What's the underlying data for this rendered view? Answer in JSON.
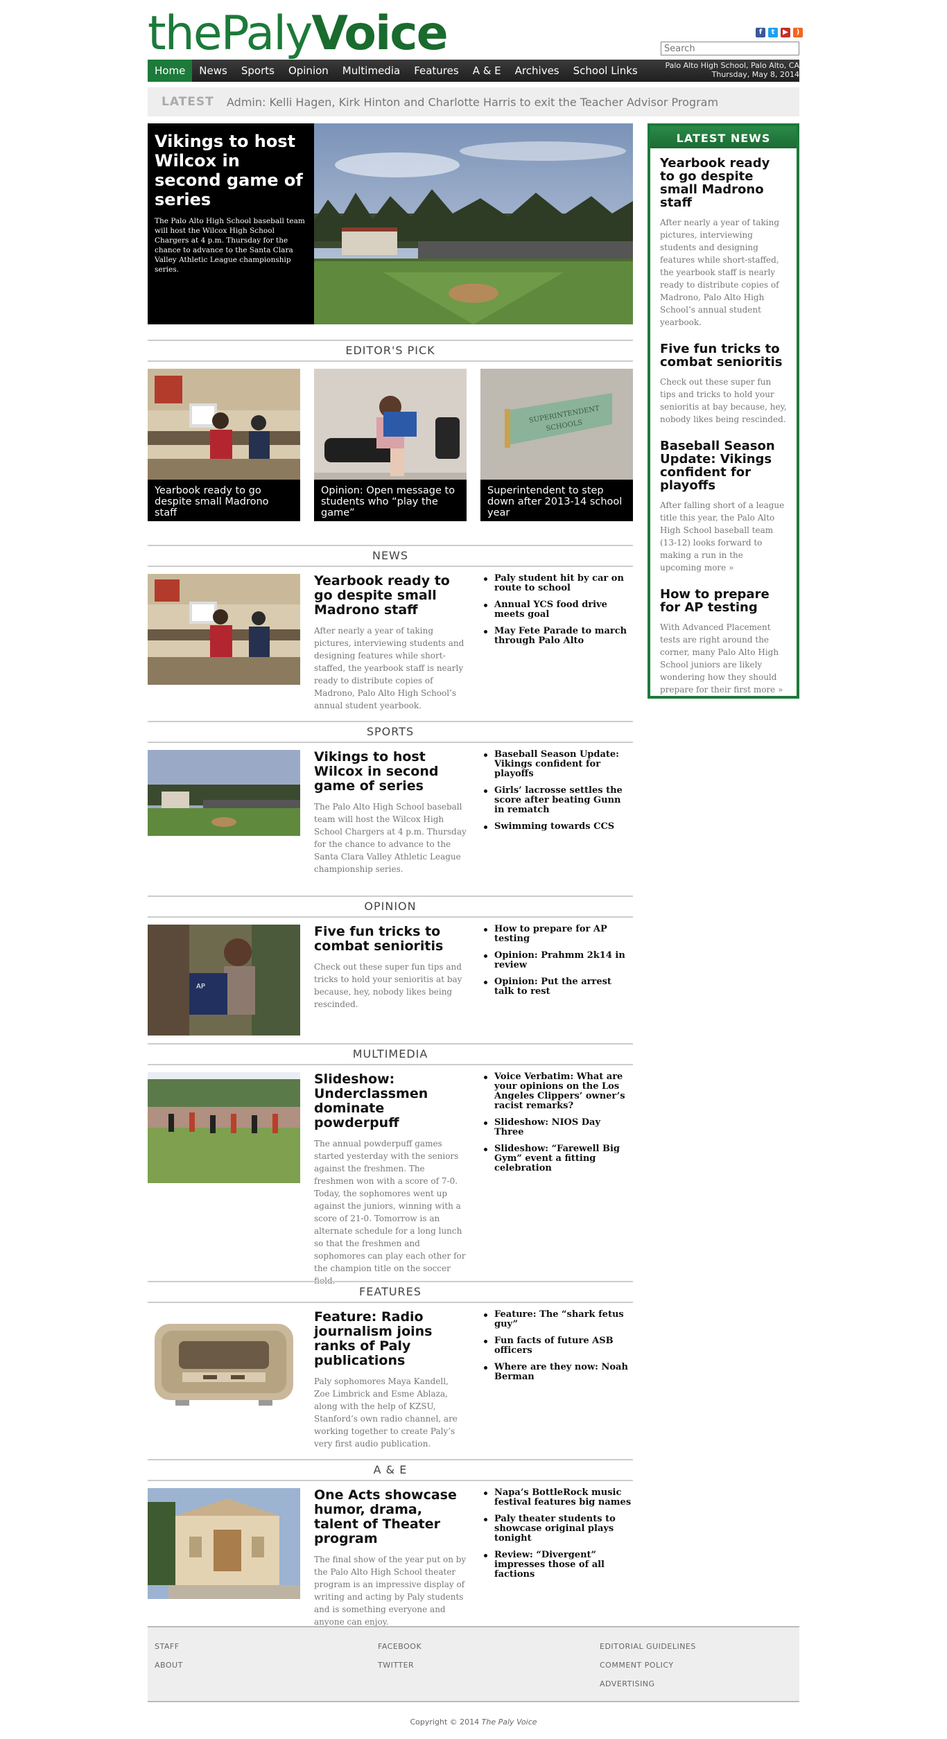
{
  "site": {
    "logo_light_1": "the",
    "logo_light_2": "Paly",
    "logo_bold": "Voice",
    "search_placeholder": "Search",
    "location": "Palo Alto High School, Palo Alto, CA",
    "date": "Thursday, May 8, 2014",
    "social": [
      "facebook-icon",
      "twitter-icon",
      "youtube-icon",
      "rss-icon"
    ]
  },
  "nav": [
    "Home",
    "News",
    "Sports",
    "Opinion",
    "Multimedia",
    "Features",
    "A & E",
    "Archives",
    "School Links"
  ],
  "ticker": {
    "label": "LATEST",
    "text": "Admin: Kelli Hagen, Kirk Hinton and Charlotte Harris to exit the Teacher Advisor Program"
  },
  "hero": {
    "title": "Vikings to host Wilcox in second game of series",
    "summary": "The Palo Alto High School baseball team will host the Wilcox High School Chargers at 4 p.m. Thursday for the chance to advance to the Santa Clara Valley Athletic League championship series."
  },
  "editors_pick": {
    "heading": "EDITOR'S PICK",
    "items": [
      "Yearbook ready to go despite small Madrono staff",
      "Opinion: Open message to students who “play the game”",
      "Superintendent to step down after 2013-14 school year"
    ]
  },
  "latest_news": {
    "heading": "LATEST NEWS",
    "items": [
      {
        "title": "Yearbook ready to go despite small Madrono staff",
        "summary": "After nearly a year of taking pictures, interviewing students and designing features while short-staffed, the yearbook staff is nearly ready to distribute copies of Madrono, Palo Alto High School’s annual student yearbook.",
        "more": ""
      },
      {
        "title": "Five fun tricks to combat senioritis",
        "summary": "Check out these super fun tips and tricks to hold your senioritis at bay because, hey, nobody likes being rescinded.",
        "more": ""
      },
      {
        "title": "Baseball Season Update: Vikings confident for playoffs",
        "summary": "After falling short of a league title this year, the Palo Alto High School baseball team (13-12) looks forward to making a run in the upcoming",
        "more": "more »"
      },
      {
        "title": "How to prepare for AP testing",
        "summary": "With Advanced Placement tests are right around the corner, many Palo Alto High School juniors are likely wondering how they should prepare for their first",
        "more": "more »"
      }
    ]
  },
  "sections": [
    {
      "heading": "NEWS",
      "title": "Yearbook ready to go despite small Madrono staff",
      "summary": "After nearly a year of taking pictures, interviewing students and designing features while short-staffed, the yearbook staff is nearly ready to distribute copies of Madrono, Palo Alto High School’s annual student yearbook.",
      "links": [
        "Paly student hit by car on route to school",
        "Annual YCS food drive meets goal",
        "May Fete Parade to march through Palo Alto"
      ]
    },
    {
      "heading": "SPORTS",
      "title": "Vikings to host Wilcox in second game of series",
      "summary": "The Palo Alto High School baseball team will host the Wilcox High School Chargers at 4 p.m. Thursday for the chance to advance to the Santa Clara Valley Athletic League championship series.",
      "links": [
        "Baseball Season Update: Vikings confident for playoffs",
        "Girls’ lacrosse settles the score after beating Gunn in rematch",
        "Swimming towards CCS"
      ]
    },
    {
      "heading": "OPINION",
      "title": "Five fun tricks to combat senioritis",
      "summary": "Check out these super fun tips and tricks to hold your senioritis at bay because, hey, nobody likes being rescinded.",
      "links": [
        "How to prepare for AP testing",
        "Opinion: Prahmm 2k14 in review",
        "Opinion: Put the arrest talk to rest"
      ]
    },
    {
      "heading": "MULTIMEDIA",
      "title": "Slideshow: Underclassmen dominate powderpuff",
      "summary": "The annual powderpuff games started yesterday with the seniors against the freshmen. The freshmen won with a score of 7-0. Today, the sophomores went up against the juniors, winning with a score of 21-0. Tomorrow is an alternate schedule for a long lunch so that the freshmen and sophomores can play each other for the champion title on the soccer field.",
      "links": [
        "Voice Verbatim: What are your opinions on the Los Angeles Clippers’ owner’s racist remarks?",
        "Slideshow: NIOS Day Three",
        "Slideshow: “Farewell Big Gym” event a fitting celebration"
      ]
    },
    {
      "heading": "FEATURES",
      "title": "Feature: Radio journalism joins ranks of Paly publications",
      "summary": "Paly sophomores Maya Kandell, Zoe Limbrick and Esme Ablaza, along with the help of KZSU, Stanford’s own radio channel, are working together to create Paly’s very first audio publication.",
      "links": [
        "Feature: The “shark fetus guy”",
        "Fun facts of future ASB officers",
        "Where are they now: Noah Berman"
      ]
    },
    {
      "heading": "A & E",
      "title": "One Acts showcase humor, drama, talent of Theater program",
      "summary": "The final show of the year put on by the Palo Alto High School theater program is an impressive display of writing and acting by Paly students and is something everyone and anyone can enjoy.",
      "links": [
        "Napa’s BottleRock music festival features big names",
        "Paly theater students to showcase original plays tonight",
        "Review: “Divergent” impresses those of all factions"
      ]
    }
  ],
  "footer": {
    "col1": [
      "STAFF",
      "ABOUT"
    ],
    "col2": [
      "FACEBOOK",
      "TWITTER"
    ],
    "col3": [
      "EDITORIAL GUIDELINES",
      "COMMENT POLICY",
      "ADVERTISING"
    ],
    "copyright_prefix": "Copyright © 2014 ",
    "copyright_name": "The Paly Voice"
  },
  "colors": {
    "brand_green": "#1c7a3a",
    "nav_dark": "#2a2a2a",
    "ticker_bg": "#eeeeee"
  }
}
